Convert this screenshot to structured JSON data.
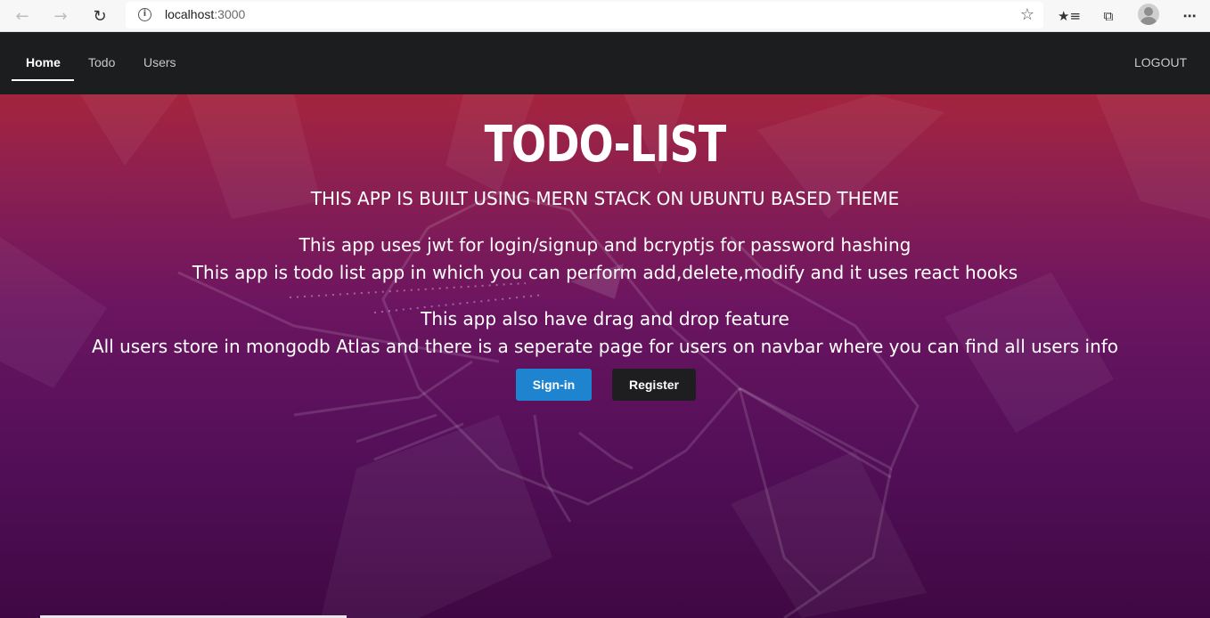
{
  "browser": {
    "url_host": "localhost",
    "url_port": ":3000",
    "icons": [
      "back-icon",
      "forward-icon",
      "refresh-icon",
      "info-icon",
      "star-icon",
      "favorites-icon",
      "collections-icon",
      "profile-icon",
      "more-icon"
    ]
  },
  "navbar": {
    "links": [
      "Home",
      "Todo",
      "Users"
    ],
    "active": "Home",
    "logout": "LOGOUT"
  },
  "hero": {
    "title": "TODO-LIST",
    "subtitle": "THIS APP IS BUILT USING MERN STACK ON UBUNTU BASED THEME",
    "lines": [
      "This app uses jwt for login/signup and bcryptjs for password hashing",
      "This app is todo list app in which you can perform add,delete,modify and it uses react hooks",
      "This app also have drag and drop feature",
      "All users store in mongodb Atlas and there is a seperate page for users on navbar where you can find all users info"
    ],
    "signin_label": "Sign-in",
    "register_label": "Register"
  },
  "colors": {
    "navbar_bg": "#1c1d1f",
    "hero_top": "#a5243e",
    "hero_bottom": "#3f0844",
    "signin_bg": "#1f84d0",
    "register_bg": "#1e1d20"
  }
}
